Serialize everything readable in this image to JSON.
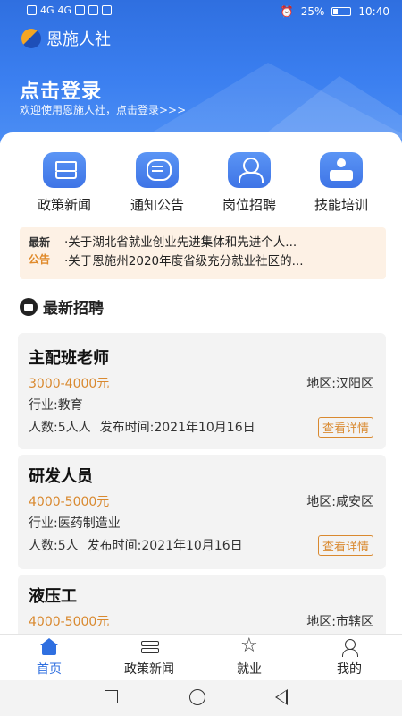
{
  "status_bar": {
    "left_labels": [
      "HD 1",
      "HD 2",
      "4G",
      "4G"
    ],
    "battery": "25%",
    "time": "10:40"
  },
  "header": {
    "app_name": "恩施人社",
    "login_title": "点击登录",
    "login_subtitle": "欢迎使用恩施人社，点击登录>>>"
  },
  "nav_grid": [
    {
      "label": "政策新闻",
      "icon": "layers-icon"
    },
    {
      "label": "通知公告",
      "icon": "message-icon"
    },
    {
      "label": "岗位招聘",
      "icon": "people-icon"
    },
    {
      "label": "技能培训",
      "icon": "training-icon"
    }
  ],
  "notice": {
    "tag_line1": "最新",
    "tag_line2": "公告",
    "items": [
      "·关于湖北省就业创业先进集体和先进个人...",
      "·关于恩施州2020年度省级充分就业社区的..."
    ]
  },
  "section": {
    "title": "最新招聘"
  },
  "jobs": [
    {
      "title": "主配班老师",
      "salary": "3000-4000元",
      "area": "地区:汉阳区",
      "industry": "行业:教育",
      "headcount": "人数:5人人",
      "publish_time": "发布时间:2021年10月16日",
      "detail_label": "查看详情"
    },
    {
      "title": "研发人员",
      "salary": "4000-5000元",
      "area": "地区:咸安区",
      "industry": "行业:医药制造业",
      "headcount": "人数:5人",
      "publish_time": "发布时间:2021年10月16日",
      "detail_label": "查看详情"
    },
    {
      "title": "液压工",
      "salary": "4000-5000元",
      "area": "地区:市辖区",
      "industry": "",
      "headcount": "",
      "publish_time": "",
      "detail_label": ""
    }
  ],
  "tabbar": [
    {
      "label": "首页",
      "icon": "home-icon",
      "active": true
    },
    {
      "label": "政策新闻",
      "icon": "news-icon",
      "active": false
    },
    {
      "label": "就业",
      "icon": "star-icon",
      "active": false
    },
    {
      "label": "我的",
      "icon": "user-icon",
      "active": false
    }
  ],
  "colors": {
    "primary": "#2f6fe0",
    "accent": "#d9892f",
    "notice_bg": "#fdf1e5"
  }
}
